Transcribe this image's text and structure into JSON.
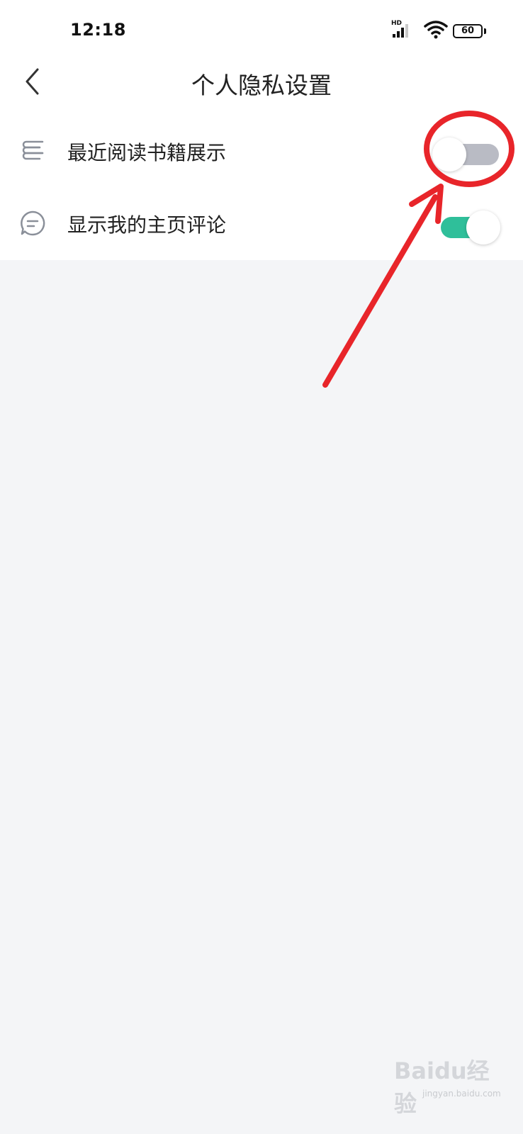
{
  "status_bar": {
    "time": "12:18",
    "network_label": "HD",
    "battery": "60"
  },
  "header": {
    "title": "个人隐私设置",
    "back_icon": "chevron-left-icon"
  },
  "settings": [
    {
      "label": "最近阅读书籍展示",
      "icon": "books-icon",
      "enabled": false
    },
    {
      "label": "显示我的主页评论",
      "icon": "comment-icon",
      "enabled": true
    }
  ],
  "colors": {
    "toggle_on": "#2fbf9a",
    "toggle_off": "#b9bbc4",
    "annotation": "#e8252a",
    "background": "#f4f5f7"
  },
  "watermark": {
    "brand": "Baidu经验",
    "url": "jingyan.baidu.com"
  }
}
